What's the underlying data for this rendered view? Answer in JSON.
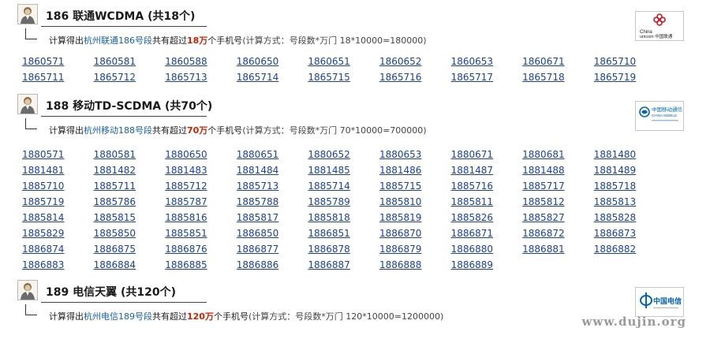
{
  "sections": [
    {
      "title": "186 联通WCDMA (共18个)",
      "summary": {
        "prefix": "计算得出",
        "city_link": "杭州联通186号段",
        "middle": "共有超过",
        "cap": "18万",
        "suffix": "个手机号",
        "formula": "(计算方式：号段数*万门 18*10000=180000)"
      },
      "logo_name": "China unicom 中国联通",
      "numbers": [
        "1860571",
        "1860581",
        "1860588",
        "1860650",
        "1860651",
        "1860652",
        "1860653",
        "1860671",
        "1865710",
        "1865711",
        "1865712",
        "1865713",
        "1865714",
        "1865715",
        "1865716",
        "1865717",
        "1865718",
        "1865719"
      ]
    },
    {
      "title": "188 移动TD-SCDMA (共70个)",
      "summary": {
        "prefix": "计算得出",
        "city_link": "杭州移动188号段",
        "middle": "共有超过",
        "cap": "70万",
        "suffix": "个手机号",
        "formula": "(计算方式：号段数*万门 70*10000=700000)"
      },
      "logo_name": "中国移动通信 CHINA MOBILE",
      "numbers": [
        "1880571",
        "1880581",
        "1880650",
        "1880651",
        "1880652",
        "1880653",
        "1880671",
        "1880681",
        "1881480",
        "1881481",
        "1881482",
        "1881483",
        "1881484",
        "1881485",
        "1881486",
        "1881487",
        "1881488",
        "1881489",
        "1885710",
        "1885711",
        "1885712",
        "1885713",
        "1885714",
        "1885715",
        "1885716",
        "1885717",
        "1885718",
        "1885719",
        "1885786",
        "1885787",
        "1885788",
        "1885789",
        "1885810",
        "1885811",
        "1885812",
        "1885813",
        "1885814",
        "1885815",
        "1885816",
        "1885817",
        "1885818",
        "1885819",
        "1885826",
        "1885827",
        "1885828",
        "1885829",
        "1885850",
        "1885851",
        "1886850",
        "1886851",
        "1886870",
        "1886871",
        "1886872",
        "1886873",
        "1886874",
        "1886875",
        "1886876",
        "1886877",
        "1886878",
        "1886879",
        "1886880",
        "1886881",
        "1886882",
        "1886883",
        "1886884",
        "1886885",
        "1886886",
        "1886887",
        "1886888",
        "1886889"
      ]
    },
    {
      "title": "189 电信天翼 (共120个)",
      "summary": {
        "prefix": "计算得出",
        "city_link": "杭州电信189号段",
        "middle": "共有超过",
        "cap": "120万",
        "suffix": "个手机号",
        "formula": "(计算方式：号段数*万门 120*10000=1200000)"
      },
      "logo_name": "中国电信",
      "numbers": []
    }
  ],
  "watermark": "www.dujin.org",
  "colors": {
    "link": "#1a3fa8",
    "city_link": "#1560b4",
    "cap": "#cc2200"
  }
}
